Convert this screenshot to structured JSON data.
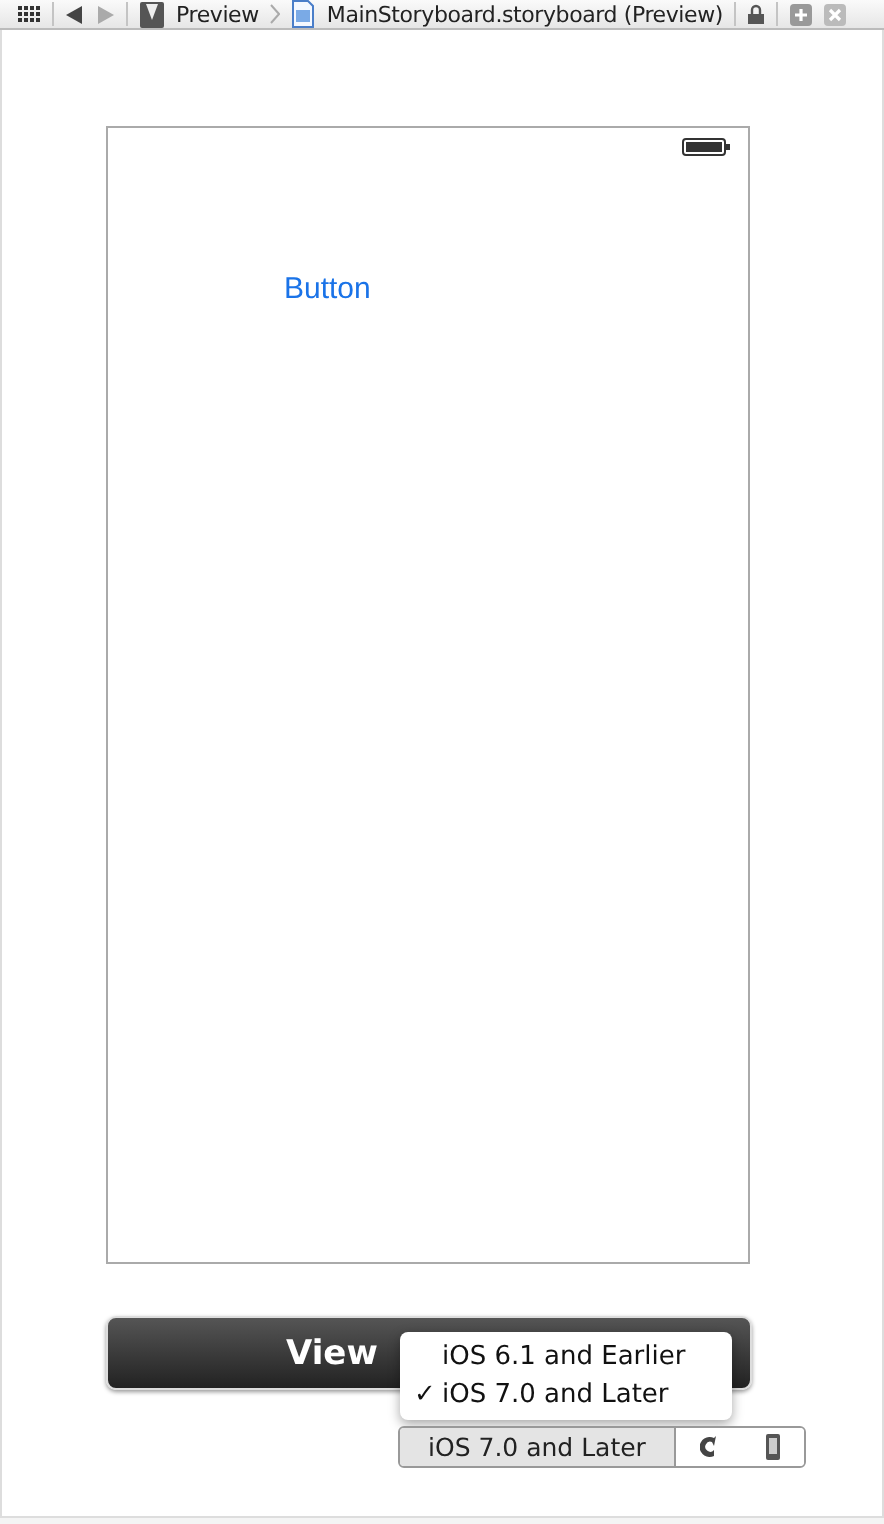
{
  "jump_bar": {
    "breadcrumbs": [
      {
        "label": "Preview",
        "kind": "preview"
      },
      {
        "label": "MainStoryboard.storyboard (Preview)",
        "kind": "file"
      }
    ]
  },
  "device": {
    "button": "Button"
  },
  "view_button": {
    "label": "View"
  },
  "version_menu": {
    "items": [
      {
        "label": "iOS 6.1 and Earlier",
        "selected": false
      },
      {
        "label": "iOS 7.0 and Later",
        "selected": true
      }
    ],
    "checkmark": "✓"
  },
  "version_selector": {
    "label": "iOS 7.0 and Later"
  }
}
